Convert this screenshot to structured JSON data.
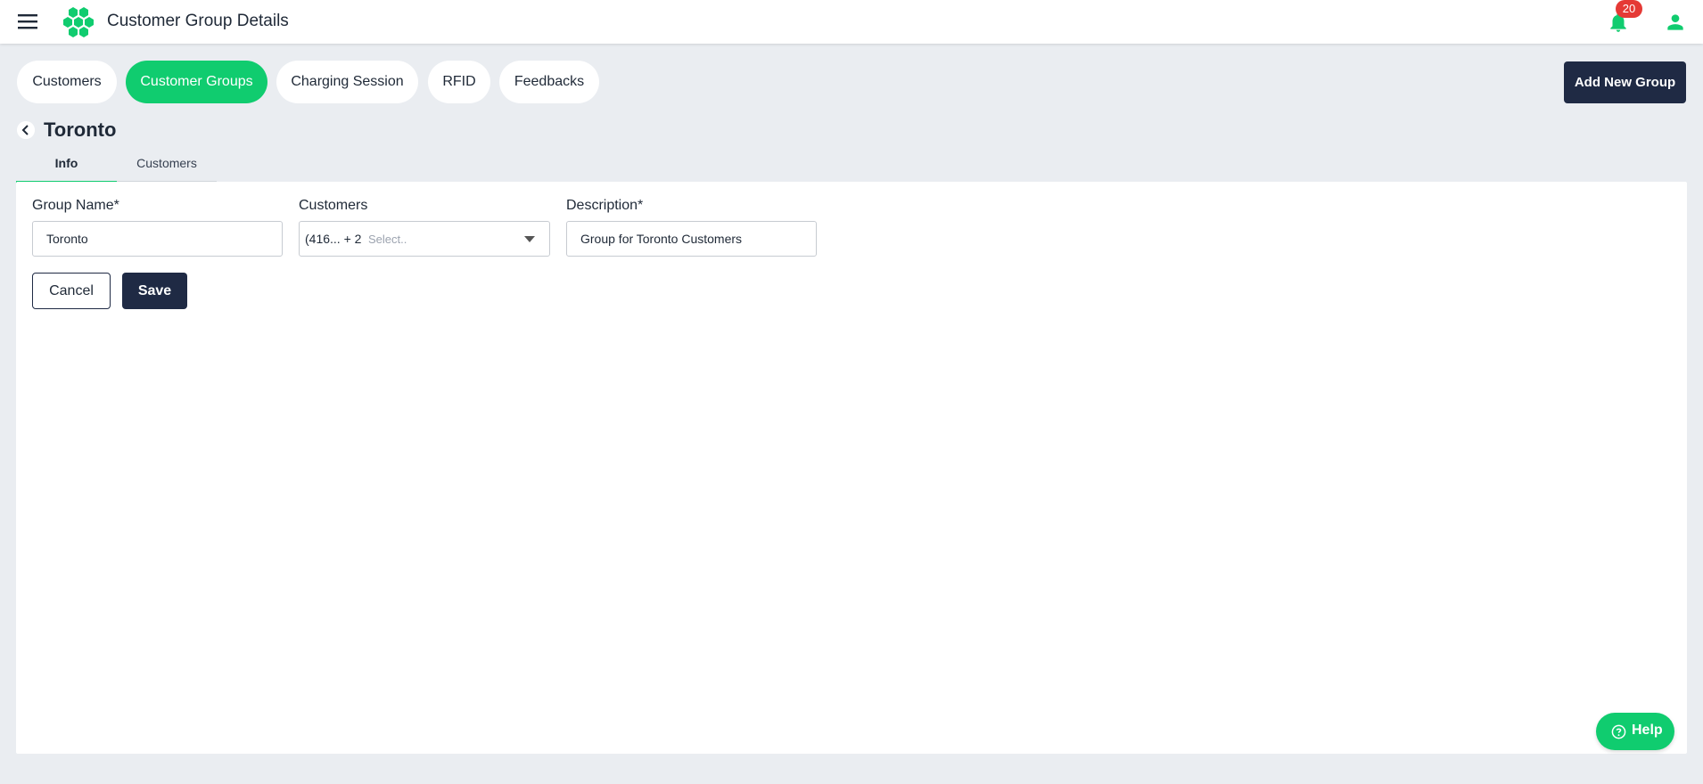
{
  "header": {
    "title": "Customer Group Details",
    "notification_count": "20",
    "icons": {
      "menu": "hamburger-menu-icon",
      "logo": "hexagon-cluster-logo",
      "notifications": "bell-icon",
      "profile": "user-icon"
    }
  },
  "nav": {
    "tabs": [
      {
        "label": "Customers",
        "active": false
      },
      {
        "label": "Customer Groups",
        "active": true
      },
      {
        "label": "Charging Session",
        "active": false
      },
      {
        "label": "RFID",
        "active": false
      },
      {
        "label": "Feedbacks",
        "active": false
      }
    ],
    "add_button_label": "Add New Group"
  },
  "page": {
    "title": "Toronto",
    "subtabs": [
      {
        "label": "Info",
        "active": true
      },
      {
        "label": "Customers",
        "active": false
      }
    ]
  },
  "form": {
    "group_name": {
      "label": "Group Name*",
      "value": "Toronto"
    },
    "customers": {
      "label": "Customers",
      "selected_text": "(416... + 2",
      "placeholder": "Select.."
    },
    "description": {
      "label": "Description*",
      "value": "Group for Toronto Customers"
    },
    "cancel_label": "Cancel",
    "save_label": "Save"
  },
  "help": {
    "label": "Help"
  },
  "colors": {
    "accent": "#10cc6f",
    "dark": "#1f2a44",
    "badge": "#e53935",
    "background": "#eaedf1"
  }
}
